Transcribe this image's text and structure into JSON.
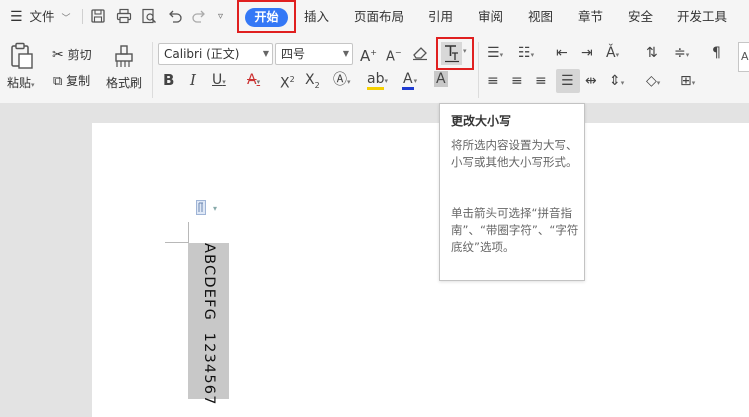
{
  "menubar": {
    "file_label": "文件",
    "tabs": [
      "开始",
      "插入",
      "页面布局",
      "引用",
      "审阅",
      "视图",
      "章节",
      "安全",
      "开发工具"
    ],
    "active_tab": "开始"
  },
  "ribbon": {
    "paste_label": "粘贴",
    "cut_label": "剪切",
    "copy_label": "复制",
    "format_painter_label": "格式刷",
    "font_name": "Calibri (正文)",
    "font_size": "四号"
  },
  "tooltip": {
    "title": "更改大小写",
    "desc": "将所选内容设置为大写、小写或其他大小写形式。",
    "hint": "单击箭头可选择“拼音指南”、“带圈字符”、“字符底纹”选项。"
  },
  "document": {
    "vertical_text": "ABCDEFG  1234567"
  },
  "colors": {
    "accent": "#3478f6",
    "highlight_border": "#e02020",
    "font_color_underline": "#1f3bd1",
    "highlight_color": "#f5d000",
    "char_shading": "#c8c8c8"
  }
}
